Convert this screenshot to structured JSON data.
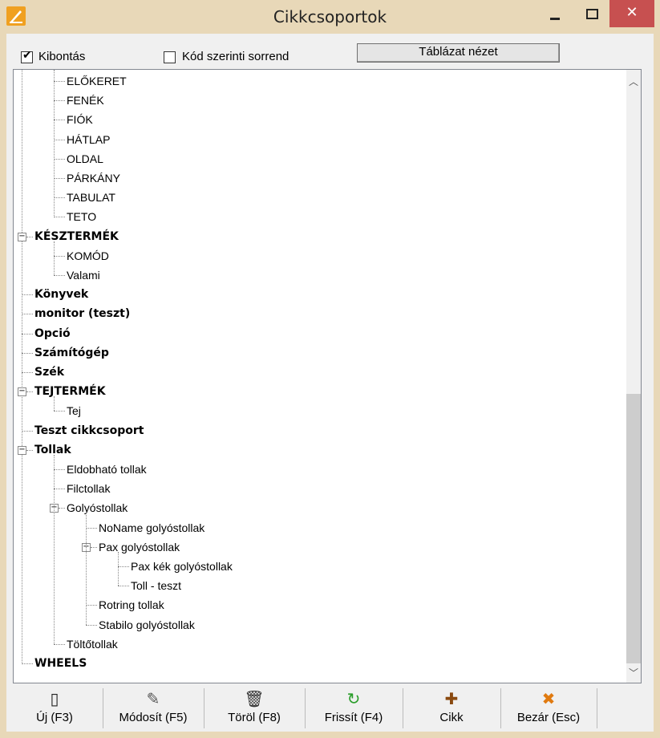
{
  "window": {
    "title": "Cikkcsoportok",
    "close_glyph": "✕"
  },
  "options": {
    "expand_label": "Kibontás",
    "expand_checked": true,
    "code_order_label": "Kód szerinti sorrend",
    "code_order_checked": false,
    "table_view_label": "Táblázat nézet"
  },
  "tree": [
    {
      "label": "ELŐKERET",
      "level": 2,
      "bold": false
    },
    {
      "label": "FENÉK",
      "level": 2,
      "bold": false
    },
    {
      "label": "FIÓK",
      "level": 2,
      "bold": false
    },
    {
      "label": "HÁTLAP",
      "level": 2,
      "bold": false
    },
    {
      "label": "OLDAL",
      "level": 2,
      "bold": false
    },
    {
      "label": "PÁRKÁNY",
      "level": 2,
      "bold": false
    },
    {
      "label": "TABULAT",
      "level": 2,
      "bold": false
    },
    {
      "label": "TETO",
      "level": 2,
      "bold": false
    },
    {
      "label": "KÉSZTERMÉK",
      "level": 1,
      "bold": true,
      "expanded": true
    },
    {
      "label": "KOMÓD",
      "level": 2,
      "bold": false
    },
    {
      "label": "Valami",
      "level": 2,
      "bold": false
    },
    {
      "label": "Könyvek",
      "level": 1,
      "bold": true
    },
    {
      "label": "monitor (teszt)",
      "level": 1,
      "bold": true
    },
    {
      "label": "Opció",
      "level": 1,
      "bold": true
    },
    {
      "label": "Számítógép",
      "level": 1,
      "bold": true
    },
    {
      "label": "Szék",
      "level": 1,
      "bold": true
    },
    {
      "label": "TEJTERMÉK",
      "level": 1,
      "bold": true,
      "expanded": true
    },
    {
      "label": "Tej",
      "level": 2,
      "bold": false
    },
    {
      "label": "Teszt cikkcsoport",
      "level": 1,
      "bold": true
    },
    {
      "label": "Tollak",
      "level": 1,
      "bold": true,
      "expanded": true
    },
    {
      "label": "Eldobható tollak",
      "level": 2,
      "bold": false
    },
    {
      "label": "Filctollak",
      "level": 2,
      "bold": false
    },
    {
      "label": "Golyóstollak",
      "level": 2,
      "bold": false,
      "expanded": true
    },
    {
      "label": "NoName golyóstollak",
      "level": 3,
      "bold": false
    },
    {
      "label": "Pax golyóstollak",
      "level": 3,
      "bold": false,
      "expanded": true
    },
    {
      "label": "Pax kék golyóstollak",
      "level": 4,
      "bold": false
    },
    {
      "label": "Toll - teszt",
      "level": 4,
      "bold": false
    },
    {
      "label": "Rotring tollak",
      "level": 3,
      "bold": false
    },
    {
      "label": "Stabilo golyóstollak",
      "level": 3,
      "bold": false
    },
    {
      "label": "Töltőtollak",
      "level": 2,
      "bold": false
    },
    {
      "label": "WHEELS",
      "level": 1,
      "bold": true
    }
  ],
  "toolbar": {
    "buttons": [
      {
        "label": "Új (F3)",
        "icon": "new-document-icon",
        "glyph": "▯",
        "color": "#222222"
      },
      {
        "label": "Módosít (F5)",
        "icon": "edit-icon",
        "glyph": "✎",
        "color": "#555555"
      },
      {
        "label": "Töröl (F8)",
        "icon": "trash-icon",
        "glyph": "🗑",
        "color": "#333333"
      },
      {
        "label": "Frissít (F4)",
        "icon": "refresh-icon",
        "glyph": "↻",
        "color": "#2a9d2a"
      },
      {
        "label": "Cikk",
        "icon": "plus-icon",
        "glyph": "✚",
        "color": "#8a4a10"
      },
      {
        "label": "Bezár (Esc)",
        "icon": "close-x-icon",
        "glyph": "✖",
        "color": "#e07a10"
      }
    ]
  },
  "colors": {
    "titlebar": "#e8d8b8",
    "close_button": "#c75050",
    "scroll_thumb": "#cdcdcd"
  }
}
